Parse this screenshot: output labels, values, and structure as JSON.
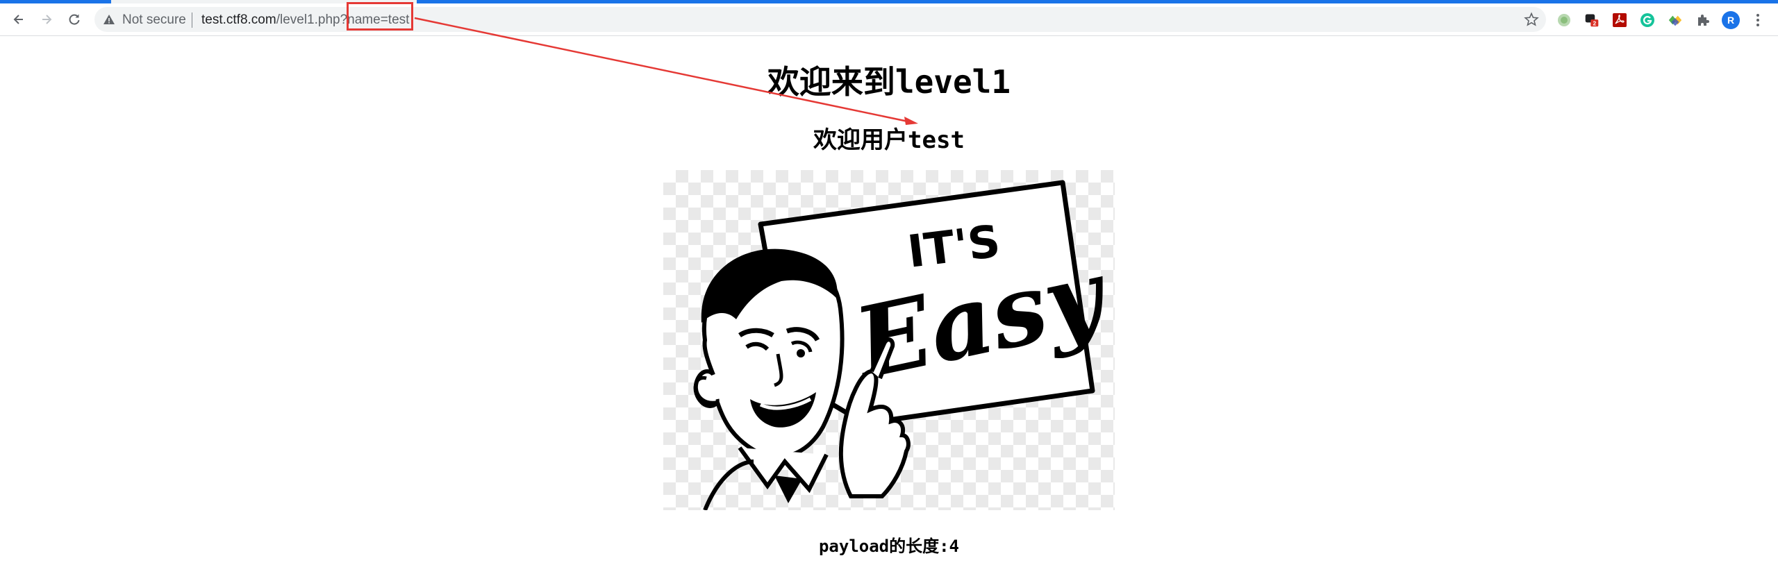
{
  "browser": {
    "not_secure_label": "Not secure",
    "url_host": "test.ctf8.com",
    "url_path": "/level1.php?",
    "url_query": "name=test",
    "extensions": [
      "circle-extension-icon",
      "badge-extension-icon",
      "pdf-extension-icon",
      "grammarly-icon",
      "diamond-extension-icon",
      "puzzle-icon"
    ],
    "extension_badge": "2",
    "profile_initial": "R"
  },
  "page": {
    "heading": "欢迎来到level1",
    "welcome_user": "欢迎用户test",
    "image_text_top": "IT'S",
    "image_text_main": "Easy",
    "payload_length": "payload的长度:4"
  },
  "colors": {
    "annotation": "#e53935",
    "accent": "#1a73e8"
  }
}
